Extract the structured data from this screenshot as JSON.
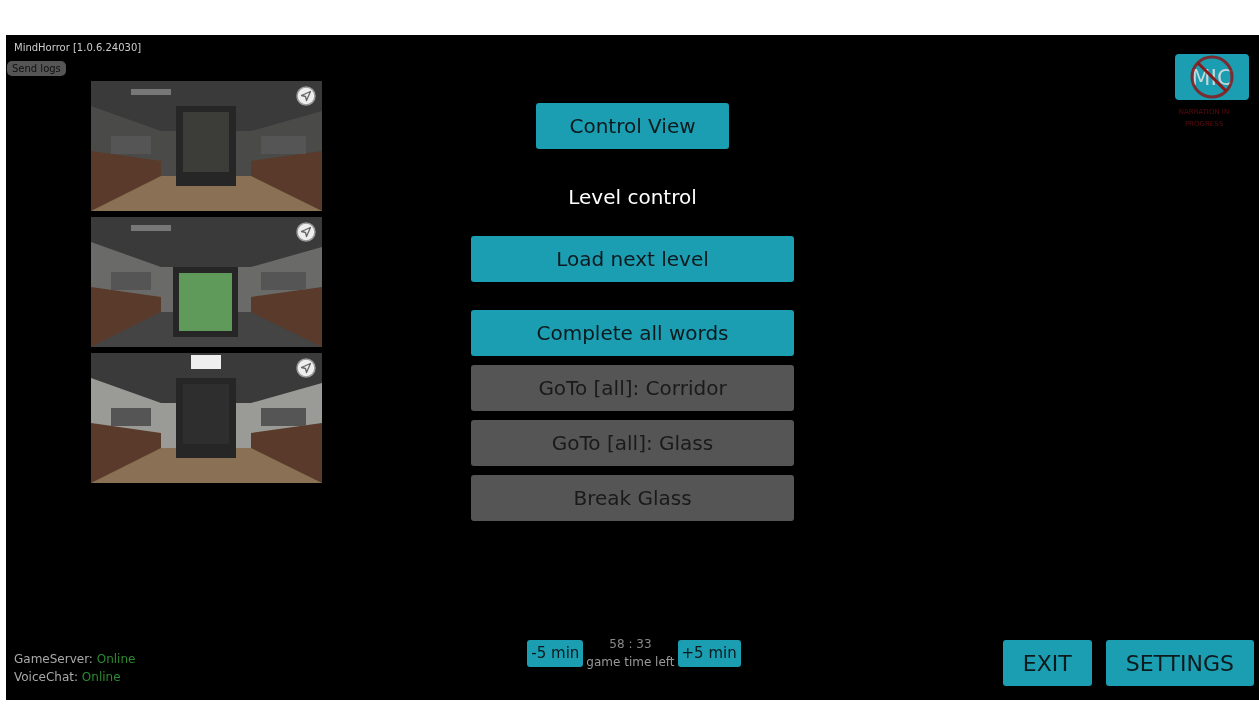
{
  "app": {
    "title": "MindHorror [1.0.6.24030]",
    "send_logs": "Send logs"
  },
  "camera_feeds": [
    {
      "kind": "picture"
    },
    {
      "kind": "picture"
    },
    {
      "kind": "picture"
    }
  ],
  "view_button": {
    "label": "Control View"
  },
  "section_title": "Level control",
  "level_actions": [
    {
      "label": "Load next level",
      "kind": "primary"
    }
  ],
  "commands": [
    {
      "label": "Complete all words",
      "kind": "primary"
    },
    {
      "label": "GoTo [all]: Corridor",
      "kind": "secondary"
    },
    {
      "label": "GoTo [all]: Glass",
      "kind": "secondary"
    },
    {
      "label": "Break Glass",
      "kind": "secondary"
    }
  ],
  "mic": {
    "label": "MIC",
    "muted": true,
    "status": "NARRATION IN PROGRESS"
  },
  "status": [
    {
      "label": "GameServer:",
      "value": "Online"
    },
    {
      "label": "VoiceChat:",
      "value": "Online"
    }
  ],
  "timer": {
    "decrease": "-5 min",
    "time": "58 : 33",
    "caption": "game time left",
    "increase": "+5 min"
  },
  "actions": [
    "EXIT",
    "SETTINGS"
  ]
}
